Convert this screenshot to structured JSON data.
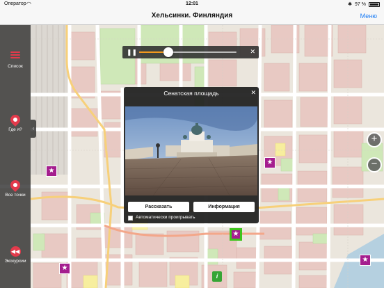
{
  "status_bar": {
    "carrier": "Оператор",
    "time": "12:01",
    "battery": "97 %",
    "battery_level": 0.97
  },
  "nav": {
    "title": "Хельсинки. Финляндия",
    "menu_label": "Меню"
  },
  "sidebar": {
    "items": [
      {
        "label": "Список",
        "icon": "list-icon"
      },
      {
        "label": "Где я?",
        "icon": "location-pin-icon"
      },
      {
        "label": "Все точки",
        "icon": "all-points-icon"
      },
      {
        "label": "Экскурсии",
        "icon": "rewind-icon"
      }
    ],
    "collapse_glyph": "‹"
  },
  "audio_player": {
    "progress": 0.3,
    "play_glyph": "❚❚",
    "close_glyph": "✕"
  },
  "popup": {
    "title": "Сенатская площадь",
    "close_glyph": "✕",
    "tell_button": "Рассказать",
    "info_button": "Информация",
    "autoplay_label": "Автоматически проигрывать"
  },
  "zoom": {
    "in": "+",
    "out": "−"
  },
  "markers": {
    "poi_glyph": "★",
    "info_glyph": "i"
  },
  "colors": {
    "accent": "#e33a4b",
    "poi": "#a41e8e",
    "link": "#1a7cf5",
    "progress": "#f39a1e",
    "selected": "#3ec41c"
  }
}
